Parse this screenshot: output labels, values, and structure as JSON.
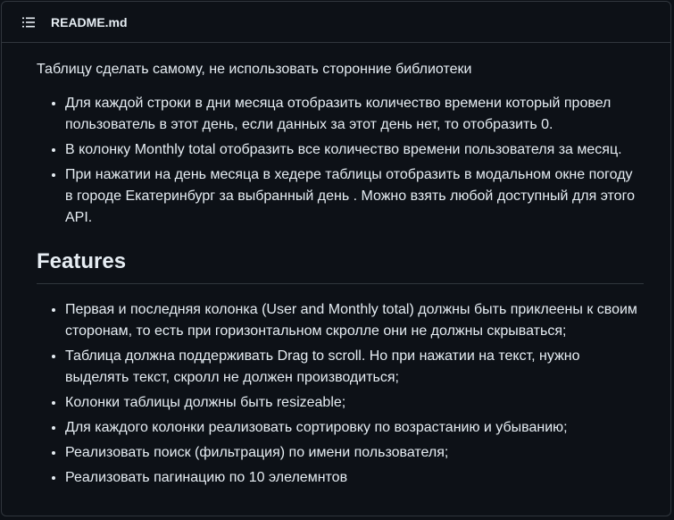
{
  "header": {
    "toc_icon": "list-unordered-icon",
    "title": "README.md"
  },
  "content": {
    "intro": "Таблицу сделать самому, не использовать сторонние библиотеки",
    "requirements": [
      "Для каждой строки в дни месяца отобразить количество времени который провел пользователь в этот день, если данных за этот день нет, то отобразить 0.",
      "В колонку Monthly total отобразить все количество времени пользователя за месяц.",
      "При нажатии на день месяца в хедере таблицы отобразить в модальном окне погоду в городе Екатеринбург за выбранный день . Можно взять любой доступный для этого API."
    ],
    "features_heading": "Features",
    "features": [
      "Первая и последняя колонка (User and Monthly total) должны быть приклеены к своим сторонам, то есть при горизонтальном скролле они не должны скрываться;",
      "Таблица должна поддерживать Drag to scroll. Но при нажатии на текст, нужно выделять текст, скролл не должен производиться;",
      "Колонки таблицы должны быть resizeable;",
      "Для каждого колонки реализовать сортировку по возрастанию и убыванию;",
      "Реализовать поиск (фильтрация) по имени пользователя;",
      "Реализовать пагинацию по 10 элелемнтов"
    ]
  },
  "colors": {
    "background": "#0d1117",
    "text": "#e6edf3",
    "border": "#30363d"
  }
}
